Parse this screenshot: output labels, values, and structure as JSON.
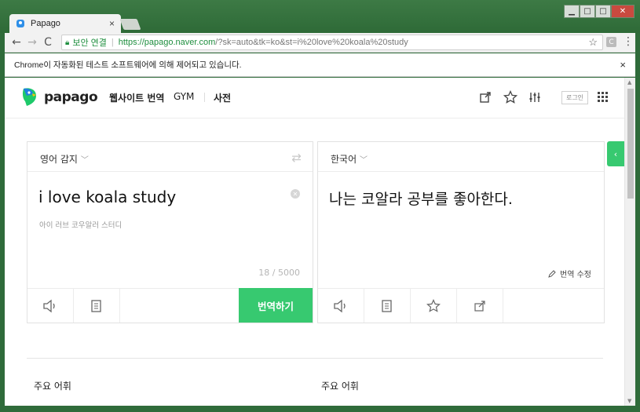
{
  "browser": {
    "tab_title": "Papago",
    "tab_close": "×",
    "window_controls": [
      "▁",
      "□",
      "✕"
    ],
    "back": "←",
    "forward": "→",
    "reload": "C",
    "security_label": "보안 연결",
    "url_host": "https://papago.naver.com",
    "url_rest": "/?sk=auto&tk=ko&st=i%20love%20koala%20study",
    "bookmark_icon": "☆",
    "extension_label": "C",
    "menu_icon": "⋮",
    "infobar_text": "Chrome이 자동화된 테스트 소프트웨어에 의해 제어되고 있습니다.",
    "infobar_close": "×"
  },
  "header": {
    "logo_text": "papago",
    "nav": [
      "웹사이트 번역",
      "GYM",
      "사전"
    ],
    "login_label": "로그인"
  },
  "source": {
    "language": "영어 감지",
    "swap_icon": "⇄",
    "text": "i love koala study",
    "pronunciation": "아이 러브 코우알러 스터디",
    "char_count": "18 / 5000",
    "translate_button": "번역하기"
  },
  "target": {
    "language": "한국어",
    "text": "나는 코알라 공부를 좋아한다.",
    "edit_label": "번역 수정"
  },
  "vocab": {
    "left_title": "주요 어휘",
    "right_title": "주요 어휘"
  },
  "colors": {
    "brand_green": "#37c970",
    "chrome_frame": "#2f6b3a"
  }
}
